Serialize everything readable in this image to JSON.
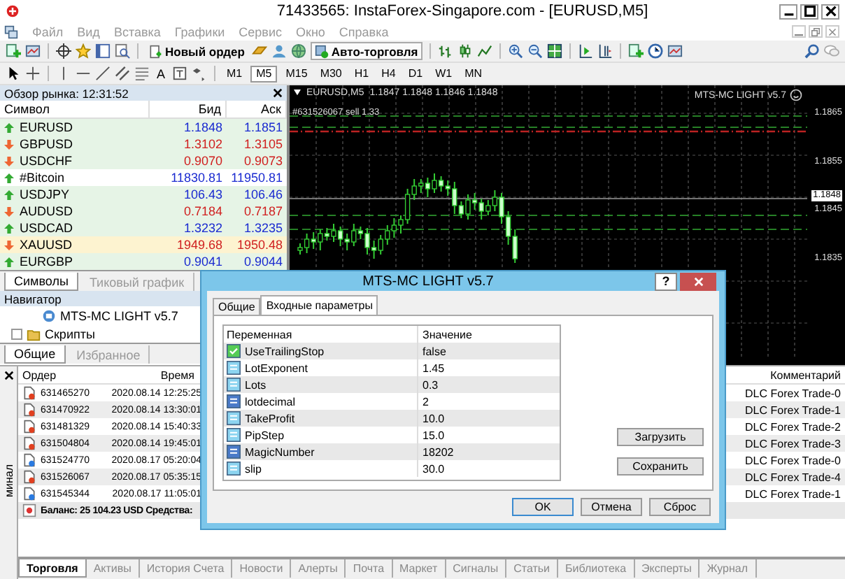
{
  "window": {
    "title": "71433565: InstaForex-Singapore.com - [EURUSD,M5]"
  },
  "menu": [
    "Файл",
    "Вид",
    "Вставка",
    "Графики",
    "Сервис",
    "Окно",
    "Справка"
  ],
  "toolbar": {
    "new_order": "Новый ордер",
    "auto_trading": "Авто-торговля",
    "text_tool": "A",
    "timeframes": [
      {
        "label": "M1",
        "selected": false
      },
      {
        "label": "M5",
        "selected": true
      },
      {
        "label": "M15",
        "selected": false
      },
      {
        "label": "M30",
        "selected": false
      },
      {
        "label": "H1",
        "selected": false
      },
      {
        "label": "H4",
        "selected": false
      },
      {
        "label": "D1",
        "selected": false
      },
      {
        "label": "W1",
        "selected": false
      },
      {
        "label": "MN",
        "selected": false
      }
    ]
  },
  "market_watch": {
    "title": "Обзор рынка: 12:31:52",
    "columns": [
      "Символ",
      "Бид",
      "Аск"
    ],
    "rows": [
      {
        "symbol": "EURUSD",
        "bid": "1.1848",
        "ask": "1.1851",
        "kind": "up",
        "color": "#e6f4e6"
      },
      {
        "symbol": "GBPUSD",
        "bid": "1.3102",
        "ask": "1.3105",
        "kind": "down",
        "color": "#e6f4e6"
      },
      {
        "symbol": "USDCHF",
        "bid": "0.9070",
        "ask": "0.9073",
        "kind": "down",
        "color": "#e6f4e6"
      },
      {
        "symbol": "#Bitcoin",
        "bid": "11830.81",
        "ask": "11950.81",
        "kind": "up",
        "color": "#ffffff"
      },
      {
        "symbol": "USDJPY",
        "bid": "106.43",
        "ask": "106.46",
        "kind": "up",
        "color": "#e6f4e6"
      },
      {
        "symbol": "AUDUSD",
        "bid": "0.7184",
        "ask": "0.7187",
        "kind": "down",
        "color": "#e6f4e6"
      },
      {
        "symbol": "USDCAD",
        "bid": "1.3232",
        "ask": "1.3235",
        "kind": "up",
        "color": "#e6f4e6"
      },
      {
        "symbol": "XAUUSD",
        "bid": "1949.68",
        "ask": "1950.48",
        "kind": "down",
        "color": "#fdf3d0"
      },
      {
        "symbol": "EURGBP",
        "bid": "0.9041",
        "ask": "0.9044",
        "kind": "up",
        "color": "#e6f4e6"
      }
    ],
    "tabs": [
      {
        "label": "Символы",
        "selected": true
      },
      {
        "label": "Тиковый график",
        "selected": false
      }
    ]
  },
  "navigator": {
    "title": "Навигатор",
    "items": [
      {
        "label": "MTS-MC LIGHT v5.7",
        "kind": "expert"
      },
      {
        "label": "Скрипты",
        "kind": "folder"
      }
    ],
    "tabs": [
      {
        "label": "Общие",
        "selected": true
      },
      {
        "label": "Избранное",
        "selected": false
      }
    ]
  },
  "chart": {
    "symbol": "EURUSD,M5",
    "quotes": "1.1847 1.1848 1.1846 1.1848",
    "expert": "MTS-MC LIGHT v5.7",
    "order_label": "#631526067 sell 1.33",
    "price_labels": [
      {
        "label": "1.1865",
        "current": false
      },
      {
        "label": "1.1855",
        "current": false
      },
      {
        "label": "1.1848",
        "current": true
      },
      {
        "label": "1.1845",
        "current": false
      },
      {
        "label": "1.1835",
        "current": false
      }
    ]
  },
  "terminal": {
    "side_label": "минал",
    "columns": [
      "Ордер",
      "Время",
      "Комментарий"
    ],
    "rows": [
      {
        "order": "631465270",
        "time": "2020.08.14 12:25:25",
        "comment": "DLC Forex Trade-0",
        "kind": "sell"
      },
      {
        "order": "631470922",
        "time": "2020.08.14 13:30:01",
        "comment": "DLC Forex Trade-1",
        "kind": "sell"
      },
      {
        "order": "631481329",
        "time": "2020.08.14 15:40:33",
        "comment": "DLC Forex Trade-2",
        "kind": "sell"
      },
      {
        "order": "631504804",
        "time": "2020.08.14 19:45:01",
        "comment": "DLC Forex Trade-3",
        "kind": "sell"
      },
      {
        "order": "631524770",
        "time": "2020.08.17 05:20:04",
        "comment": "DLC Forex Trade-0",
        "kind": "buy"
      },
      {
        "order": "631526067",
        "time": "2020.08.17 05:35:15",
        "comment": "DLC Forex Trade-4",
        "kind": "sell"
      },
      {
        "order": "631545344",
        "time": "2020.08.17 11:05:01",
        "comment": "DLC Forex Trade-1",
        "kind": "buy"
      }
    ],
    "balance": "Баланс: 25 104.23 USD Средства:",
    "tabs": [
      {
        "label": "Торговля",
        "selected": true
      },
      {
        "label": "Активы",
        "selected": false
      },
      {
        "label": "История Счета",
        "selected": false
      },
      {
        "label": "Новости",
        "selected": false
      },
      {
        "label": "Алерты",
        "selected": false
      },
      {
        "label": "Почта",
        "selected": false
      },
      {
        "label": "Маркет",
        "selected": false
      },
      {
        "label": "Сигналы",
        "selected": false
      },
      {
        "label": "Статьи",
        "selected": false
      },
      {
        "label": "Библиотека",
        "selected": false
      },
      {
        "label": "Эксперты",
        "selected": false
      },
      {
        "label": "Журнал",
        "selected": false
      }
    ]
  },
  "dialog": {
    "title": "MTS-MC LIGHT v5.7",
    "help": "?",
    "tabs": [
      {
        "label": "Общие",
        "selected": false
      },
      {
        "label": "Входные параметры",
        "selected": true
      }
    ],
    "columns": [
      "Переменная",
      "Значение"
    ],
    "params": [
      {
        "name": "UseTrailingStop",
        "value": "false",
        "kind": "bool"
      },
      {
        "name": "LotExponent",
        "value": "1.45",
        "kind": "double"
      },
      {
        "name": "Lots",
        "value": "0.3",
        "kind": "double"
      },
      {
        "name": "lotdecimal",
        "value": "2",
        "kind": "int"
      },
      {
        "name": "TakeProfit",
        "value": "10.0",
        "kind": "double"
      },
      {
        "name": "PipStep",
        "value": "15.0",
        "kind": "double"
      },
      {
        "name": "MagicNumber",
        "value": "18202",
        "kind": "int"
      },
      {
        "name": "slip",
        "value": "30.0",
        "kind": "double"
      }
    ],
    "side_buttons": [
      "Загрузить",
      "Сохранить"
    ],
    "buttons": [
      "OK",
      "Отмена",
      "Сброс"
    ]
  }
}
